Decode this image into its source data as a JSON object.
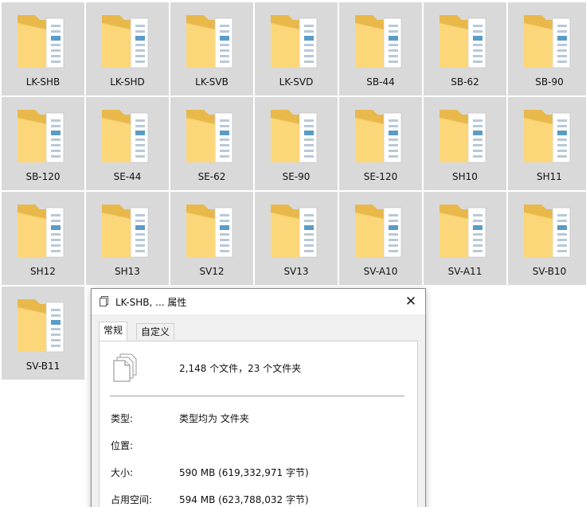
{
  "folders": [
    "LK-SHB",
    "LK-SHD",
    "LK-SVB",
    "LK-SVD",
    "SB-44",
    "SB-62",
    "SB-90",
    "SB-120",
    "SE-44",
    "SE-62",
    "SE-90",
    "SE-120",
    "SH10",
    "SH11",
    "SH12",
    "SH13",
    "SV12",
    "SV13",
    "SV-A10",
    "SV-A11",
    "SV-B10",
    "SV-B11"
  ],
  "icons": {
    "folder": "folder-icon",
    "dialog_title": "copy-icon",
    "multiple_files": "multiple-files-icon",
    "close": "close-icon"
  },
  "colors": {
    "tile_selected": "#d9d9d9",
    "folder_back": "#e8b84a",
    "folder_front": "#fcd77a",
    "dialog_bg": "#f0f0f0"
  },
  "dialog": {
    "title": "LK-SHB, ... 属性",
    "close_label": "✕",
    "tabs": [
      {
        "label": "常规",
        "active": true
      },
      {
        "label": "自定义",
        "active": false
      }
    ],
    "summary": "2,148 个文件，23 个文件夹",
    "rows": [
      {
        "label": "类型:",
        "value": "类型均为 文件夹"
      },
      {
        "label": "位置:",
        "value": ""
      },
      {
        "label": "大小:",
        "value": "590 MB (619,332,971 字节)"
      },
      {
        "label": "占用空间:",
        "value": "594 MB (623,788,032 字节)"
      }
    ]
  }
}
